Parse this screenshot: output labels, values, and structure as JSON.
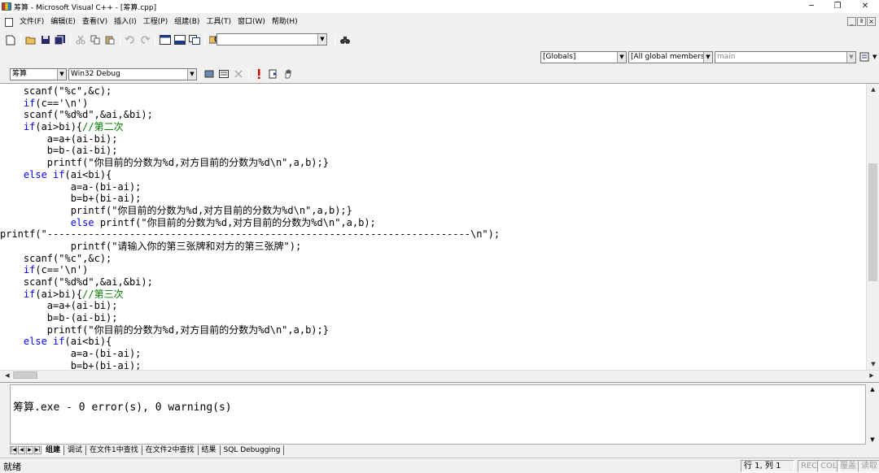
{
  "window": {
    "title": "筹算 - Microsoft Visual C++ - [筹算.cpp]"
  },
  "window_buttons": {
    "minimize": "─",
    "maximize": "❐",
    "close": "✕"
  },
  "menu": [
    "文件(F)",
    "编辑(E)",
    "查看(V)",
    "插入(I)",
    "工程(P)",
    "组建(B)",
    "工具(T)",
    "窗口(W)",
    "帮助(H)"
  ],
  "mdi_buttons": [
    "_",
    "ª",
    "×"
  ],
  "toolbar": {
    "find_combo_value": "",
    "globals_combo": "[Globals]",
    "members_combo": "[All global members",
    "function_combo": "main",
    "project_combo": "筹算",
    "config_combo": "Win32 Debug"
  },
  "code_lines": [
    [
      {
        "t": "    scanf(\"%c\",&c);"
      }
    ],
    [
      {
        "t": "    "
      },
      {
        "t": "if",
        "k": "kw"
      },
      {
        "t": "(c=='\\n')"
      }
    ],
    [
      {
        "t": "    scanf(\"%d%d\",&ai,&bi);"
      }
    ],
    [
      {
        "t": "    "
      },
      {
        "t": "if",
        "k": "kw"
      },
      {
        "t": "(ai>bi){"
      },
      {
        "t": "//第二次",
        "k": "cm"
      }
    ],
    [
      {
        "t": "        a=a+(ai-bi);"
      }
    ],
    [
      {
        "t": "        b=b-(ai-bi);"
      }
    ],
    [
      {
        "t": "        printf(\"你目前的分数为%d,对方目前的分数为%d\\n\",a,b);}"
      }
    ],
    [
      {
        "t": "    "
      },
      {
        "t": "else",
        "k": "kw"
      },
      {
        "t": " "
      },
      {
        "t": "if",
        "k": "kw"
      },
      {
        "t": "(ai<bi){"
      }
    ],
    [
      {
        "t": "            a=a-(bi-ai);"
      }
    ],
    [
      {
        "t": "            b=b+(bi-ai);"
      }
    ],
    [
      {
        "t": "            printf(\"你目前的分数为%d,对方目前的分数为%d\\n\",a,b);}"
      }
    ],
    [
      {
        "t": "            "
      },
      {
        "t": "else",
        "k": "kw"
      },
      {
        "t": " printf(\"你目前的分数为%d,对方目前的分数为%d\\n\",a,b);"
      }
    ],
    [
      {
        "t": "printf(\"------------------------------------------------------------------------\\n\");"
      }
    ],
    [
      {
        "t": "            printf(\"请输入你的第三张牌和对方的第三张牌\");"
      }
    ],
    [
      {
        "t": "    scanf(\"%c\",&c);"
      }
    ],
    [
      {
        "t": "    "
      },
      {
        "t": "if",
        "k": "kw"
      },
      {
        "t": "(c=='\\n')"
      }
    ],
    [
      {
        "t": "    scanf(\"%d%d\",&ai,&bi);"
      }
    ],
    [
      {
        "t": "    "
      },
      {
        "t": "if",
        "k": "kw"
      },
      {
        "t": "(ai>bi){"
      },
      {
        "t": "//第三次",
        "k": "cm"
      }
    ],
    [
      {
        "t": "        a=a+(ai-bi);"
      }
    ],
    [
      {
        "t": "        b=b-(ai-bi);"
      }
    ],
    [
      {
        "t": "        printf(\"你目前的分数为%d,对方目前的分数为%d\\n\",a,b);}"
      }
    ],
    [
      {
        "t": "    "
      },
      {
        "t": "else",
        "k": "kw"
      },
      {
        "t": " "
      },
      {
        "t": "if",
        "k": "kw"
      },
      {
        "t": "(ai<bi){"
      }
    ],
    [
      {
        "t": "            a=a-(bi-ai);"
      }
    ],
    [
      {
        "t": "            b=b+(bi-ai);"
      }
    ]
  ],
  "output": {
    "text": "筹算.exe - 0 error(s), 0 warning(s)"
  },
  "output_tabs": [
    "组建",
    "调试",
    "在文件1中查找",
    "在文件2中查找",
    "结果",
    "SQL Debugging"
  ],
  "status": {
    "ready": "就绪",
    "position": "行 1, 列 1",
    "rec": "REC",
    "col": "COL",
    "ovr": "覆盖",
    "read": "读取"
  }
}
